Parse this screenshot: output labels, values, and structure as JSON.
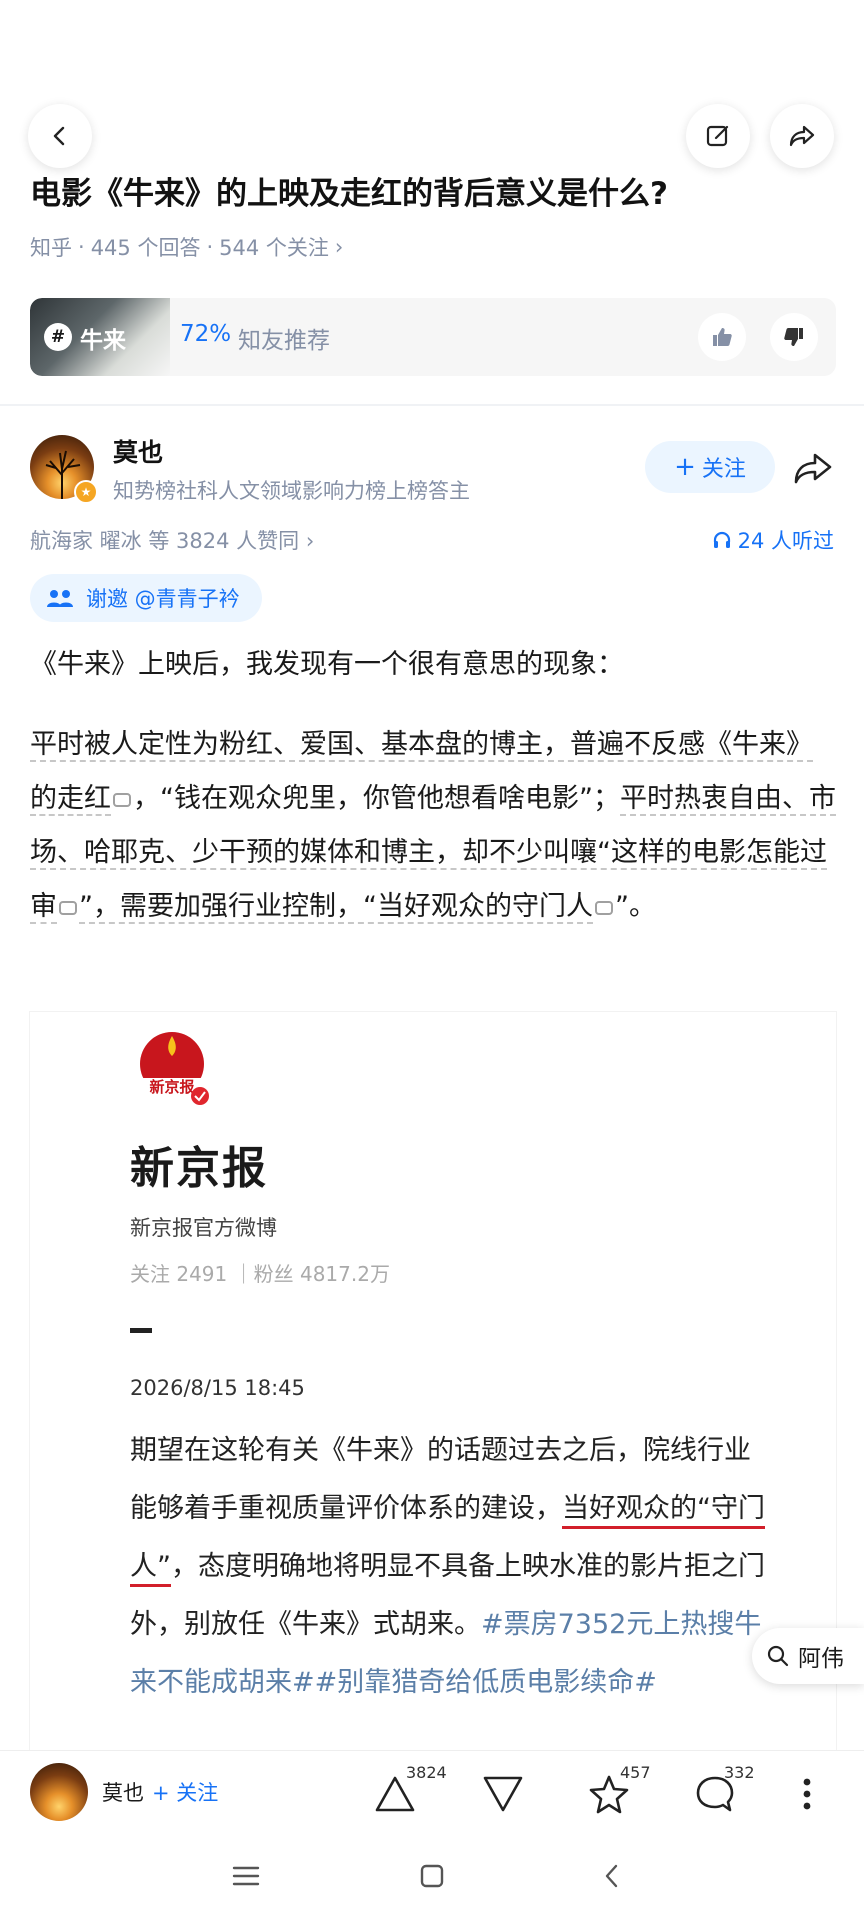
{
  "header": {
    "back_icon": "chevron-left-icon",
    "edit_icon": "edit-icon",
    "share_icon": "share-icon"
  },
  "question": {
    "title": "电影《牛来》的上映及走红的背后意义是什么?",
    "source": "知乎",
    "answers": "445 个回答",
    "followers": "544 个关注",
    "sep": "·",
    "chevron": "›"
  },
  "topic": {
    "hash": "#",
    "name": "牛来",
    "percent": "72%",
    "recommend": "知友推荐"
  },
  "answer": {
    "author": "莫也",
    "bio": "知势榜社科人文领域影响力榜上榜答主",
    "follow": "关注",
    "follow_plus": "+",
    "voters": "航海家 曜冰 等 3824 人赞同 ›",
    "listen": "24 人听过",
    "invite": "谢邀 @青青子衿",
    "p1": "《牛来》上映后，我发现有一个很有意思的现象：",
    "p2_a": "平时被人定性为粉红、爱国、基本盘的博主，普遍不反感《牛来》的走红",
    "p2_b": "，“钱在观众兜里，你管他想看啥电影”；",
    "p2_c": "平时热衷自由、市场、哈耶克、少干预的媒体和博主，却不少叫嚷“这样的电影怎能过审",
    "p2_d": "”，需要加强行业控制，“当好观众的守门人",
    "p2_e": "”。"
  },
  "screenshot": {
    "logo_text": "新京报",
    "name": "新京报",
    "subtitle": "新京报官方微博",
    "stats": "关注 2491 ｜粉丝 4817.2万",
    "time": "2026/8/15 18:45",
    "body_a": "期望在这轮有关《牛来》的话题过去之后，院线行业能够着手重视质量评价体系的建设，",
    "body_b": "当好观众的“守门人”",
    "body_c": "，态度明确地将明显不具备上映水准的影片拒之门外，别放任《牛来》式胡来。",
    "tags": "#票房7352元上热搜牛来不能成胡来##别靠猎奇给低质电影续命#"
  },
  "bubble": {
    "label": "阿伟"
  },
  "bottom": {
    "author": "莫也",
    "follow": "+ 关注",
    "upvotes": "3824",
    "favorites": "457",
    "comments": "332"
  },
  "colors": {
    "accent": "#1772f6",
    "meta": "#8590a6",
    "red": "#d21f2a"
  }
}
